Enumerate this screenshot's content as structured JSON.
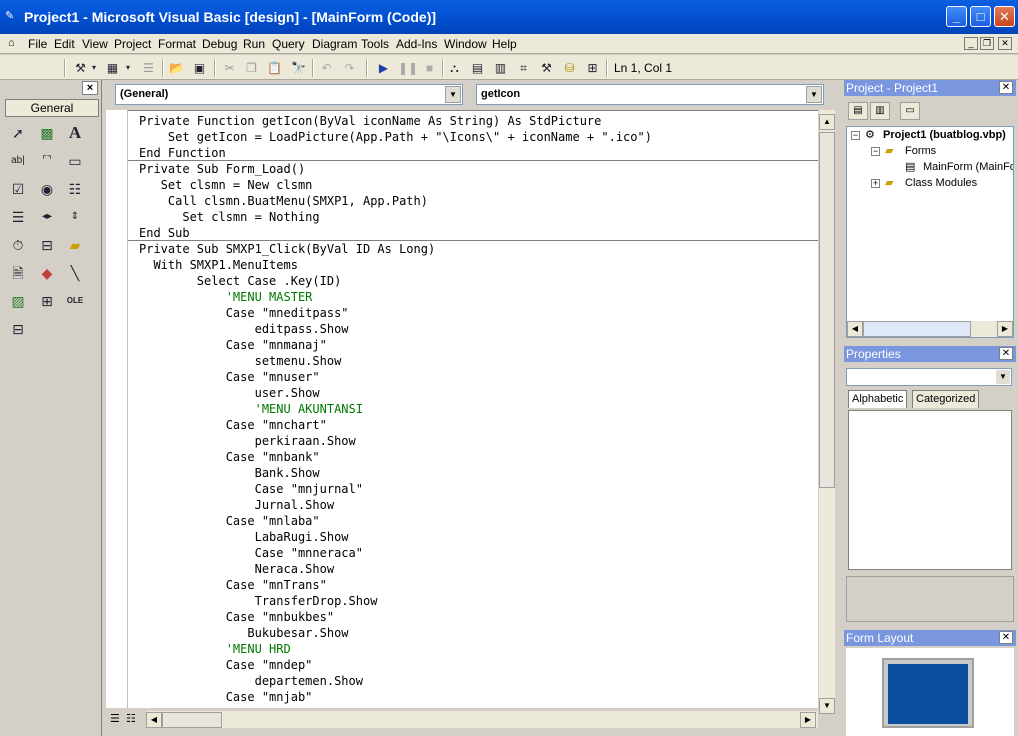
{
  "window": {
    "title": "Project1 - Microsoft Visual Basic [design] - [MainForm (Code)]",
    "icon": "vb-app-icon"
  },
  "menu": {
    "items": [
      "File",
      "Edit",
      "View",
      "Project",
      "Format",
      "Debug",
      "Run",
      "Query",
      "Diagram",
      "Tools",
      "Add-Ins",
      "Window",
      "Help"
    ]
  },
  "toolbar": {
    "position_text": "Ln 1, Col 1"
  },
  "toolbox": {
    "tab_label": "General",
    "tools": [
      "pointer",
      "picturebox",
      "label",
      "textbox",
      "frame",
      "commandbutton",
      "checkbox",
      "optionbutton",
      "combobox",
      "listbox",
      "hscrollbar",
      "vscrollbar",
      "timer",
      "drivelistbox",
      "dirlistbox",
      "filelistbox",
      "shape",
      "line",
      "image",
      "data",
      "ole",
      "extra-control"
    ],
    "close_label": "×"
  },
  "code": {
    "object_combo": "(General)",
    "procedure_combo": "getIcon",
    "lines": [
      {
        "text": "Private Function getIcon(ByVal iconName As String) As StdPicture",
        "comment": false
      },
      {
        "text": "    Set getIcon = LoadPicture(App.Path + \"\\Icons\\\" + iconName + \".ico\")",
        "comment": false
      },
      {
        "text": "End Function",
        "comment": false
      },
      {
        "text": "Private Sub Form_Load()",
        "comment": false
      },
      {
        "text": "   Set clsmn = New clsmn",
        "comment": false
      },
      {
        "text": "    Call clsmn.BuatMenu(SMXP1, App.Path)",
        "comment": false
      },
      {
        "text": "      Set clsmn = Nothing",
        "comment": false
      },
      {
        "text": "End Sub",
        "comment": false
      },
      {
        "text": "Private Sub SMXP1_Click(ByVal ID As Long)",
        "comment": false
      },
      {
        "text": "  With SMXP1.MenuItems",
        "comment": false
      },
      {
        "text": "        Select Case .Key(ID)",
        "comment": false
      },
      {
        "text": "            'MENU MASTER",
        "comment": true
      },
      {
        "text": "            Case \"mneditpass\"",
        "comment": false
      },
      {
        "text": "                editpass.Show",
        "comment": false
      },
      {
        "text": "            Case \"mnmanaj\"",
        "comment": false
      },
      {
        "text": "                setmenu.Show",
        "comment": false
      },
      {
        "text": "            Case \"mnuser\"",
        "comment": false
      },
      {
        "text": "                user.Show",
        "comment": false
      },
      {
        "text": "                'MENU AKUNTANSI",
        "comment": true
      },
      {
        "text": "            Case \"mnchart\"",
        "comment": false
      },
      {
        "text": "                perkiraan.Show",
        "comment": false
      },
      {
        "text": "            Case \"mnbank\"",
        "comment": false
      },
      {
        "text": "                Bank.Show",
        "comment": false
      },
      {
        "text": "                Case \"mnjurnal\"",
        "comment": false
      },
      {
        "text": "                Jurnal.Show",
        "comment": false
      },
      {
        "text": "            Case \"mnlaba\"",
        "comment": false
      },
      {
        "text": "                LabaRugi.Show",
        "comment": false
      },
      {
        "text": "                Case \"mnneraca\"",
        "comment": false
      },
      {
        "text": "                Neraca.Show",
        "comment": false
      },
      {
        "text": "            Case \"mnTrans\"",
        "comment": false
      },
      {
        "text": "                TransferDrop.Show",
        "comment": false
      },
      {
        "text": "            Case \"mnbukbes\"",
        "comment": false
      },
      {
        "text": "               Bukubesar.Show",
        "comment": false
      },
      {
        "text": "            'MENU HRD",
        "comment": true
      },
      {
        "text": "            Case \"mndep\"",
        "comment": false
      },
      {
        "text": "                departemen.Show",
        "comment": false
      },
      {
        "text": "            Case \"mnjab\"",
        "comment": false
      }
    ]
  },
  "project_explorer": {
    "title": "Project - Project1",
    "root": "Project1 (buatblog.vbp)",
    "forms_folder": "Forms",
    "form_item": "MainForm (MainForm)",
    "class_folder": "Class Modules"
  },
  "properties": {
    "title": "Properties",
    "tab_alphabetic": "Alphabetic",
    "tab_categorized": "Categorized"
  },
  "form_layout": {
    "title": "Form Layout"
  },
  "colors": {
    "titlebar": "#0453d6",
    "panel_title": "#7a96df",
    "comment": "#007a00",
    "form_preview": "#0a4fa0"
  }
}
